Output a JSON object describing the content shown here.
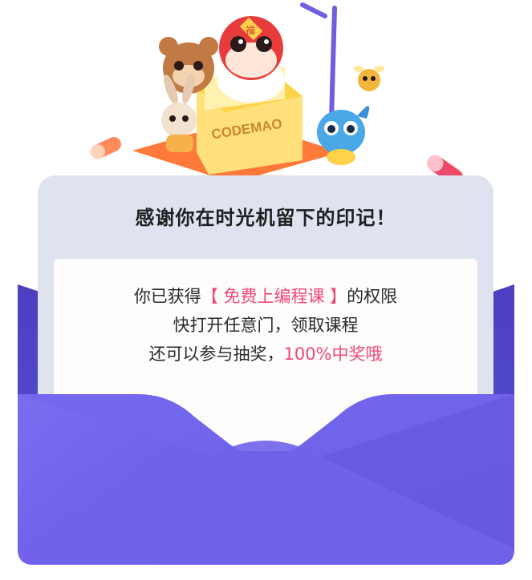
{
  "illustration": {
    "box_label": "CODEMAO",
    "mask_glyph": "福"
  },
  "letter": {
    "title": "感谢你在时光机留下的印记！",
    "line1_prefix": "你已获得",
    "line1_highlight": "【 免费上编程课 】",
    "line1_suffix": "的权限",
    "line2": "快打开任意门，领取课程",
    "line3_prefix": "还可以参与抽奖，",
    "line3_highlight": "100%中奖哦"
  },
  "colors": {
    "highlight": "#f0467a",
    "envelope_front": "#6e63e6",
    "envelope_back": "#5148c8",
    "letter_bg": "#dfe3f0"
  }
}
